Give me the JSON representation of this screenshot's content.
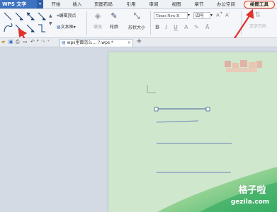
{
  "app": {
    "title": "WPS 文字"
  },
  "menu": [
    "开始",
    "插入",
    "页面布局",
    "引用",
    "审阅",
    "视图",
    "章节",
    "办公空间",
    "绘图工具"
  ],
  "ribbon": {
    "edit_vertex": "编辑顶点",
    "text_box": "文本框",
    "fill": "填充",
    "outline": "轮廓",
    "shape_size": "形状大小",
    "font_name": "Times New R",
    "font_size": "四号",
    "text_direction": "文字方向",
    "bold": "B",
    "italic": "I",
    "underline": "U"
  },
  "tabs": {
    "document": "wps里面怎么... ?.wps *"
  },
  "watermark": {
    "title": "格子啦",
    "url": "gezila.com"
  },
  "colors": {
    "accent": "#3d72c1",
    "highlight": "#e0312a",
    "paper": "#cfe7cd",
    "line": "#6a86b8"
  }
}
